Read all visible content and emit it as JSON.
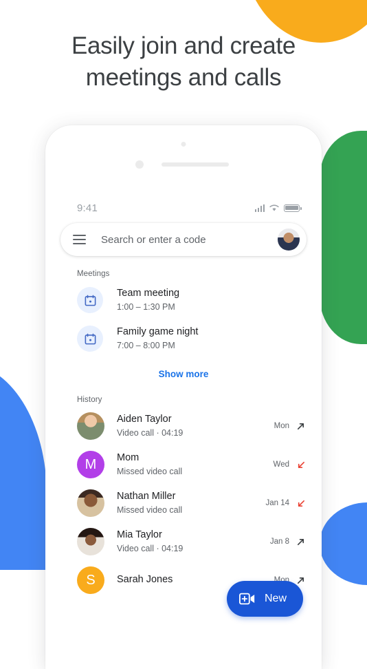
{
  "headline": {
    "line1": "Easily join and create",
    "line2": "meetings and calls"
  },
  "colors": {
    "yellow": "#f9ab1c",
    "green": "#34a353",
    "blue": "#4285f4",
    "fab_blue": "#1a56d6",
    "link_blue": "#1a73e8",
    "missed_red": "#ea4335",
    "purple_avatar": "#b23fe8",
    "yellow_avatar": "#f9ab1c"
  },
  "phone": {
    "status_bar": {
      "time": "9:41",
      "signal_icon": "signal-bars-icon",
      "wifi_icon": "wifi-icon",
      "battery_icon": "battery-icon"
    },
    "search": {
      "menu_icon": "hamburger-menu-icon",
      "placeholder": "Search or enter a code",
      "avatar_icon": "account-avatar"
    },
    "meetings": {
      "label": "Meetings",
      "items": [
        {
          "icon": "calendar-icon",
          "title": "Team meeting",
          "time": "1:00 – 1:30 PM"
        },
        {
          "icon": "calendar-icon",
          "title": "Family game night",
          "time": "7:00 – 8:00 PM"
        }
      ],
      "show_more": "Show more"
    },
    "history": {
      "label": "History",
      "items": [
        {
          "name": "Aiden Taylor",
          "detail": "Video call ·  04:19",
          "date": "Mon",
          "arrow": "outgoing-call-arrow-icon",
          "avatar_type": "photo",
          "avatar_class": "ph-aiden",
          "initial": ""
        },
        {
          "name": "Mom",
          "detail": "Missed video call",
          "date": "Wed",
          "arrow": "missed-call-arrow-icon",
          "avatar_type": "initial",
          "avatar_color": "#b23fe8",
          "initial": "M"
        },
        {
          "name": "Nathan Miller",
          "detail": "Missed video call",
          "date": "Jan 14",
          "arrow": "missed-call-arrow-icon",
          "avatar_type": "photo",
          "avatar_class": "ph-nathan",
          "initial": ""
        },
        {
          "name": "Mia Taylor",
          "detail": "Video call ·  04:19",
          "date": "Jan 8",
          "arrow": "outgoing-call-arrow-icon",
          "avatar_type": "photo",
          "avatar_class": "ph-mia",
          "initial": ""
        },
        {
          "name": "Sarah Jones",
          "detail": "",
          "date": "Mon",
          "arrow": "outgoing-call-arrow-icon",
          "avatar_type": "initial",
          "avatar_color": "#f9ab1c",
          "initial": "S"
        }
      ]
    },
    "fab": {
      "icon": "new-video-call-icon",
      "label": "New"
    }
  }
}
